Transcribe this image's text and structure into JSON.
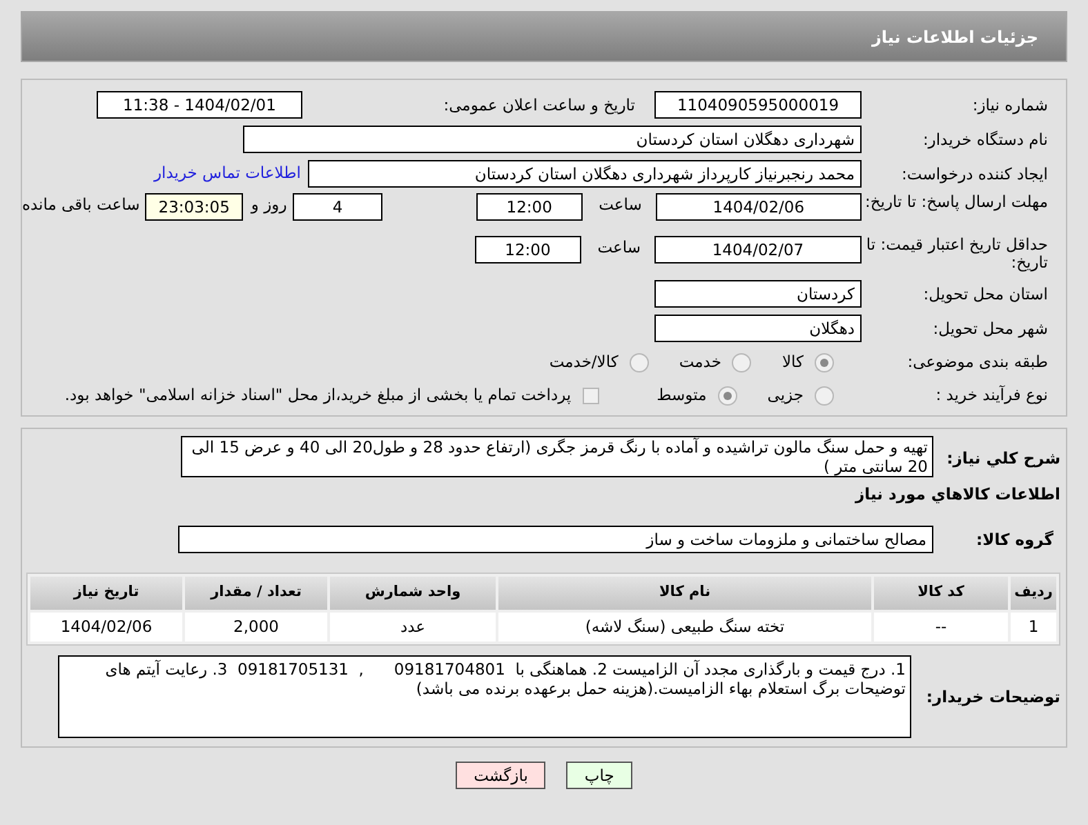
{
  "header": {
    "title": "جزئیات اطلاعات نیاز"
  },
  "need_number": {
    "label": "شماره نیاز:",
    "value": "1104090595000019"
  },
  "announce": {
    "label": "تاریخ و ساعت اعلان عمومی:",
    "value": "1404/02/01 - 11:38"
  },
  "buyer": {
    "label": "نام دستگاه خریدار:",
    "value": "شهرداری دهگلان استان کردستان"
  },
  "creator": {
    "label": "ایجاد کننده درخواست:",
    "value": "محمد رنجبرنیاز کارپرداز شهرداری دهگلان استان کردستان",
    "link": "اطلاعات تماس خریدار"
  },
  "deadline": {
    "label": "مهلت ارسال پاسخ: تا تاریخ:",
    "date": "1404/02/06",
    "time_label": "ساعت",
    "time": "12:00",
    "days": "4",
    "days_label": "روز و",
    "remaining": "23:03:05",
    "remaining_label": "ساعت باقی مانده"
  },
  "validity": {
    "label": "حداقل تاریخ اعتبار قیمت: تا تاریخ:",
    "date": "1404/02/07",
    "time_label": "ساعت",
    "time": "12:00"
  },
  "province": {
    "label": "استان محل تحویل:",
    "value": "کردستان"
  },
  "city": {
    "label": "شهر محل تحویل:",
    "value": "دهگلان"
  },
  "category": {
    "label": "طبقه بندی موضوعی:",
    "options": [
      {
        "label": "کالا",
        "selected": true
      },
      {
        "label": "خدمت",
        "selected": false
      },
      {
        "label": "کالا/خدمت",
        "selected": false
      }
    ]
  },
  "process": {
    "label": "نوع فرآیند خرید :",
    "options": [
      {
        "label": "جزیی",
        "selected": false
      },
      {
        "label": "متوسط",
        "selected": true
      }
    ],
    "payment": {
      "label": "پرداخت تمام یا بخشی از مبلغ خرید،از محل \"اسناد خزانه اسلامی\" خواهد بود.",
      "checked": false
    }
  },
  "description": {
    "label": "شرح کلي نياز:",
    "value": "تهیه و حمل سنگ مالون تراشیده و آماده با رنگ قرمز جگری (ارتفاع حدود 28 و طول20 الی 40 و عرض 15 الی 20 سانتی متر )"
  },
  "goods_title": "اطلاعات کالاهاي مورد نياز",
  "group": {
    "label": "گروه کالا:",
    "value": "مصالح ساختمانی و ملزومات ساخت و ساز"
  },
  "table": {
    "columns": [
      "ردیف",
      "کد کالا",
      "نام کالا",
      "واحد شمارش",
      "تعداد / مقدار",
      "تاریخ نیاز"
    ],
    "rows": [
      [
        "1",
        "--",
        "تخته سنگ طبیعی (سنگ لاشه)",
        "عدد",
        "2,000",
        "1404/02/06"
      ]
    ]
  },
  "notes": {
    "label": "توضیحات خریدار:",
    "value": "1. درج قیمت و بارگذاری مجدد آن الزامیست 2. هماهنگی با  09181704801      ,  09181705131  3. رعایت آیتم های توضیحات برگ استعلام بهاء الزامیست.(هزینه حمل برعهده برنده می باشد)"
  },
  "buttons": [
    {
      "label": "چاپ",
      "kind": "print"
    },
    {
      "label": "بازگشت",
      "kind": "back"
    }
  ]
}
